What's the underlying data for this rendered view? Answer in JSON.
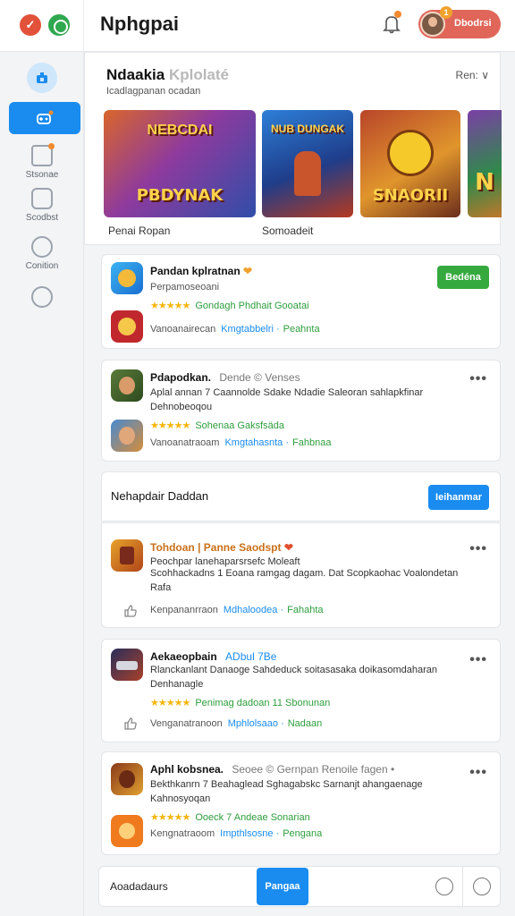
{
  "header": {
    "title": "Nphgpai",
    "user_name": "Dbodrsi",
    "notification_count": "1"
  },
  "sidebar": {
    "items": [
      {
        "label": "Stsonae"
      },
      {
        "label": "Scodbst"
      },
      {
        "label": "Conition"
      }
    ]
  },
  "featured": {
    "title": "Ndaakia",
    "title_accent": "Kplolaté",
    "subtitle": "Icadlagpanan ocadan",
    "sort_label": "Ren: ∨",
    "thumbs": [
      {
        "top_text": "NEBCDAI",
        "caption": "PBDYNAK",
        "label": "Penai Ropan"
      },
      {
        "top_text": "NUB DUNGAK",
        "caption": "",
        "label": "Somoadeit"
      },
      {
        "top_text": "",
        "caption": "SNAORII",
        "label": ""
      },
      {
        "top_text": "",
        "caption": "N",
        "label": ""
      }
    ]
  },
  "cards": [
    {
      "name": "Pandan kplratnan",
      "sub": "Perpamoseoani",
      "action": "Bedéna",
      "stars": "★★★★★",
      "star_text": "Gondagh Phdhait Gooatai",
      "meta_gray": "Vanoanairecan",
      "meta_blue": "Kmgtabbelri ·",
      "meta_green": "Peahnta"
    },
    {
      "name": "Pdapodkan.",
      "sub": "Dende © Venses",
      "desc": "Aplal annan 7 Caannolde Sdake Ndadie Saleoran sahlapkfinar Dehnobeoqou",
      "stars": "★★★★★",
      "star_text": "Sohenaa Gaksfsäda",
      "meta_gray": "Vanoanatraoam",
      "meta_blue": "Kmgtahasnta ·",
      "meta_green": "Fahbnaa"
    },
    {
      "section_title": "Nehapdair Daddan",
      "section_action": "Ieihanmar"
    },
    {
      "name": "Tohdoan | Panne Saodspt",
      "sub": "Peochpar lanehaparsrsefc Moleaft",
      "desc": "Scohhackadns 1 Eoana ramgag dagam. Dat Scopkaohac Voalondetan Rafa",
      "meta_gray": "Kenpananrraon",
      "meta_blue": "Mdhaloodea ·",
      "meta_green": "Fahahta"
    },
    {
      "name": "Aekaeopbain",
      "sub": "ADbul 7Be",
      "desc": "Rlanckanlant Danaoge Sahdeduck soitasasaka doikasomdaharan Denhanagle",
      "stars": "★★★★★",
      "star_text": "Penimag dadoan 11 Sbonunan",
      "meta_gray": "Venganatranoon",
      "meta_blue": "Mphlolsaao ·",
      "meta_green": "Nadaan"
    },
    {
      "name": "Aphl kobsnea.",
      "sub": "Seoee © Gernpan Renoile fagen •",
      "desc": "Bekthkanrn 7 Beahaglead Sghagabskc Sarnanjt ahangaenage Kahnosyoqan",
      "stars": "★★★★★",
      "star_text": "Ooeck 7 Andeae Sonarian",
      "meta_gray": "Kengnatraoom",
      "meta_blue": "Impthlsosne ·",
      "meta_green": "Pengana"
    }
  ],
  "bottom": {
    "label": "Aoadadaurs",
    "button": "Pangaa"
  },
  "colors": {
    "primary": "#1a8cf0",
    "green": "#36a93e",
    "star": "#f5b50a",
    "accent_orange": "#f28a2e"
  }
}
